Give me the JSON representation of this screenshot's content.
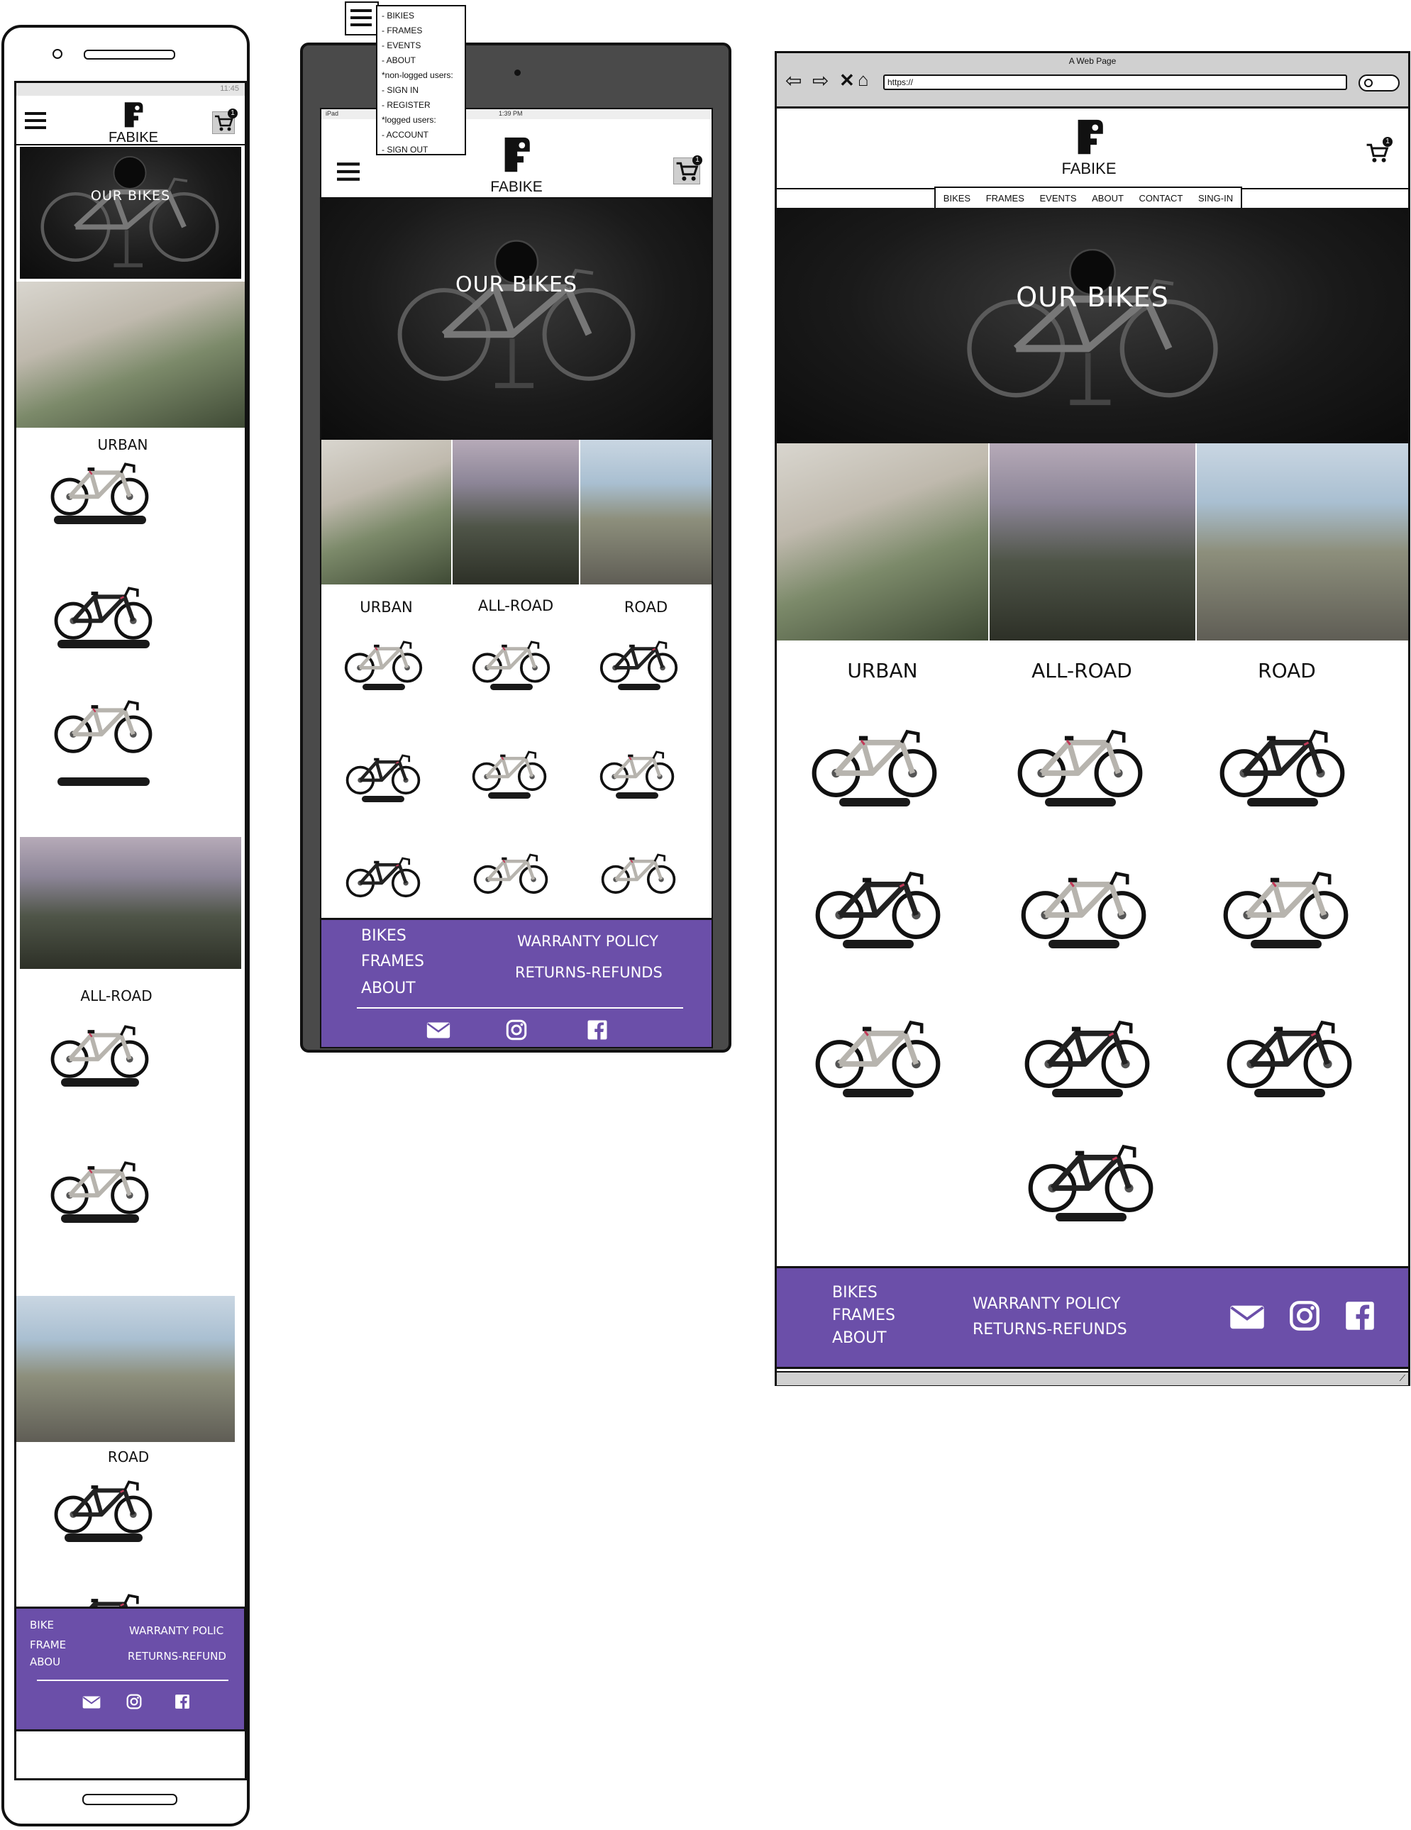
{
  "brand": {
    "name": "FABIKE"
  },
  "hero": {
    "title": "OUR BIKES"
  },
  "categories": [
    "URBAN",
    "ALL-ROAD",
    "ROAD"
  ],
  "cart": {
    "count": "1"
  },
  "mobile": {
    "status_time": "11:45",
    "footer": {
      "links": [
        "BIKE",
        "FRAME",
        "ABOU"
      ],
      "policies": [
        "WARRANTY POLIC",
        "RETURNS-REFUND"
      ]
    }
  },
  "tablet": {
    "status_left": "iPad",
    "status_time": "1:39 PM",
    "menu_items": [
      "- BIKIES",
      "- FRAMES",
      "- EVENTS",
      "- ABOUT",
      "*non-logged users:",
      "- SIGN IN",
      "- REGISTER",
      "*logged users:",
      "- ACCOUNT",
      "- SIGN OUT"
    ],
    "footer": {
      "links": [
        "BIKES",
        "FRAMES",
        "ABOUT"
      ],
      "policies": [
        "WARRANTY POLICY",
        "RETURNS-REFUNDS"
      ]
    }
  },
  "desktop": {
    "window_title": "A Web Page",
    "url": "https://",
    "nav": [
      "BIKES",
      "FRAMES",
      "EVENTS",
      "ABOUT",
      "CONTACT",
      "SING-IN"
    ],
    "footer": {
      "links": [
        "BIKES",
        "FRAMES",
        "ABOUT"
      ],
      "policies": [
        "WARRANTY POLICY",
        "RETURNS-REFUNDS"
      ]
    }
  },
  "icons": {
    "menu": "hamburger-icon",
    "cart": "cart-icon",
    "email": "email-icon",
    "instagram": "instagram-icon",
    "facebook": "facebook-icon",
    "logo": "fabike-logo-icon"
  },
  "colors": {
    "footer": "#6b4fa9",
    "frame": "#111111",
    "hero": "#1a1a1a"
  }
}
